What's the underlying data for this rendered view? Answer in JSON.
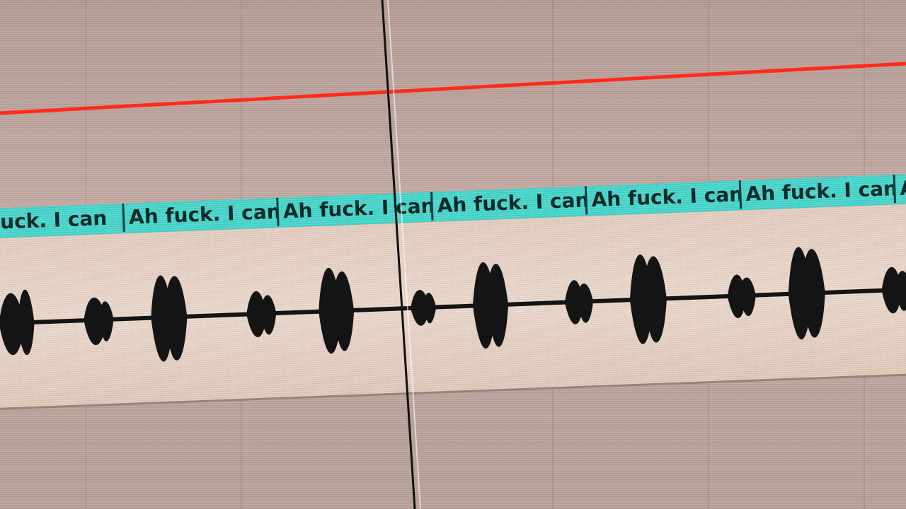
{
  "track": {
    "region_clip_label": "Ah fuck. I can",
    "first_clip_partial_label": "uck. I can",
    "region_color": "#42d6cc",
    "waveform_color": "#141414",
    "automation_color": "#ff2a1a",
    "playhead_color": "#111111"
  }
}
